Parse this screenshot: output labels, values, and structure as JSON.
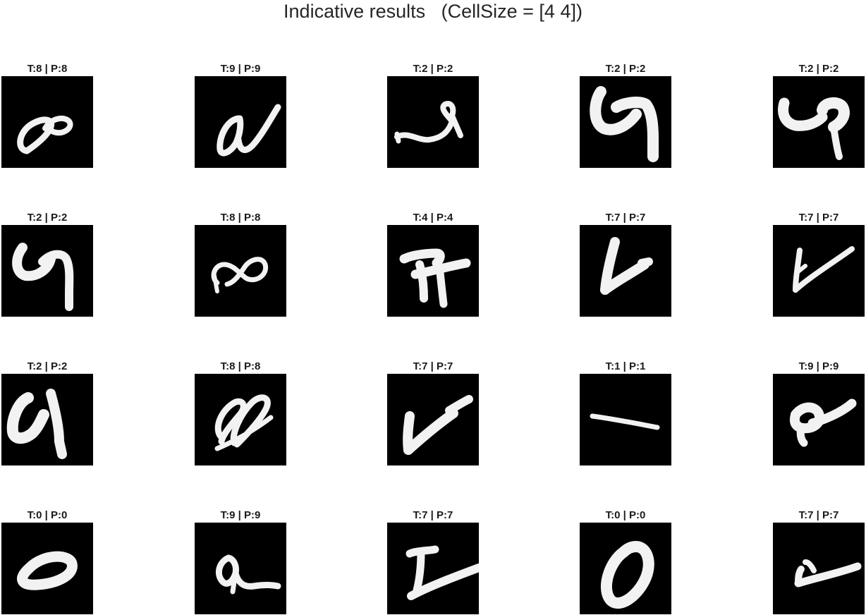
{
  "title": "Indicative results   (CellSize = [4 4])",
  "panels": [
    {
      "caption": "T:8 | P:8",
      "glyph": "figure-eight-loop"
    },
    {
      "caption": "T:9 | P:9",
      "glyph": "slanted-a-nine"
    },
    {
      "caption": "T:2 | P:2",
      "glyph": "hook-with-loop"
    },
    {
      "caption": "T:2 | P:2",
      "glyph": "bold-q-shape"
    },
    {
      "caption": "T:2 | P:2",
      "glyph": "bold-q-shape-tail"
    },
    {
      "caption": "T:2 | P:2",
      "glyph": "q-shape"
    },
    {
      "caption": "T:8 | P:8",
      "glyph": "infinity-eight"
    },
    {
      "caption": "T:4 | P:4",
      "glyph": "open-four"
    },
    {
      "caption": "T:7 | P:7",
      "glyph": "check-seven"
    },
    {
      "caption": "T:7 | P:7",
      "glyph": "thin-check-seven"
    },
    {
      "caption": "T:2 | P:2",
      "glyph": "c-shape-two"
    },
    {
      "caption": "T:8 | P:8",
      "glyph": "double-loop-eight"
    },
    {
      "caption": "T:7 | P:7",
      "glyph": "checkmark-seven"
    },
    {
      "caption": "T:1 | P:1",
      "glyph": "horizontal-stroke-one"
    },
    {
      "caption": "T:9 | P:9",
      "glyph": "blob-nine"
    },
    {
      "caption": "T:0 | P:0",
      "glyph": "flat-oval-zero"
    },
    {
      "caption": "T:9 | P:9",
      "glyph": "script-nine"
    },
    {
      "caption": "T:7 | P:7",
      "glyph": "angled-seven"
    },
    {
      "caption": "T:0 | P:0",
      "glyph": "upright-oval-zero"
    },
    {
      "caption": "T:7 | P:7",
      "glyph": "short-check-seven"
    }
  ]
}
